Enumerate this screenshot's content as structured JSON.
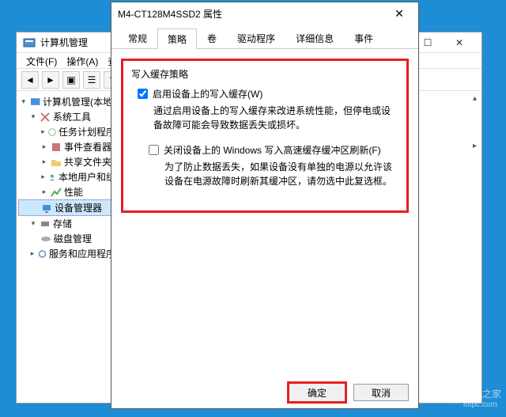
{
  "bgWindow": {
    "title": "计算机管理",
    "menu": {
      "file": "文件(F)",
      "action": "操作(A)",
      "view": "查"
    },
    "tree": {
      "root": "计算机管理(本地)",
      "systemTools": "系统工具",
      "taskScheduler": "任务计划程序",
      "eventViewer": "事件查看器",
      "sharedFolders": "共享文件夹",
      "localUsers": "本地用户和组",
      "performance": "性能",
      "deviceManager": "设备管理器",
      "storage": "存储",
      "diskMgmt": "磁盘管理",
      "services": "服务和应用程序"
    }
  },
  "dialog": {
    "title": "M4-CT128M4SSD2 属性",
    "tabs": {
      "general": "常规",
      "policies": "策略",
      "volumes": "卷",
      "driver": "驱动程序",
      "details": "详细信息",
      "events": "事件"
    },
    "groupLabel": "写入缓存策略",
    "enableCache": "启用设备上的写入缓存(W)",
    "enableCacheDesc": "通过启用设备上的写入缓存来改进系统性能，但停电或设备故障可能会导致数据丢失或损坏。",
    "disableFlush": "关闭设备上的 Windows 写入高速缓存缓冲区刷新(F)",
    "disableFlushDesc": "为了防止数据丢失，如果设备没有单独的电源以允许该设备在电源故障时刷新其缓冲区，请勿选中此复选框。",
    "ok": "确定",
    "cancel": "取消"
  },
  "watermark": {
    "text": "装机之家",
    "url": "lotpc.com"
  }
}
